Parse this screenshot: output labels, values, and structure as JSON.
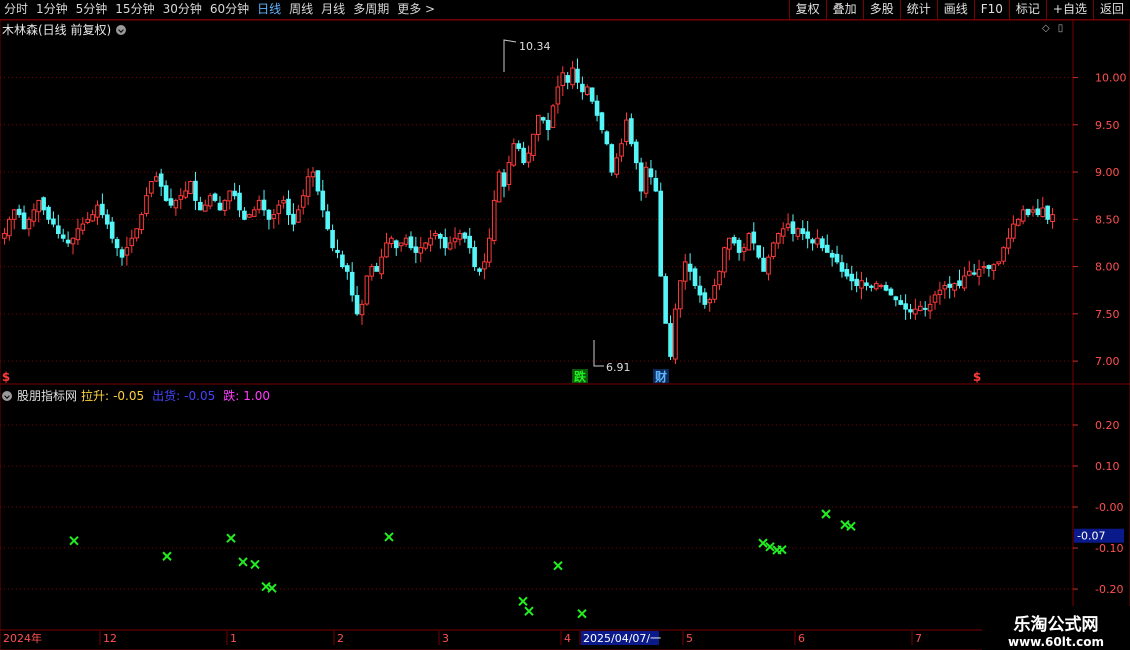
{
  "toolbar": {
    "periods": [
      {
        "label": "分时",
        "active": false
      },
      {
        "label": "1分钟",
        "active": false
      },
      {
        "label": "5分钟",
        "active": false
      },
      {
        "label": "15分钟",
        "active": false
      },
      {
        "label": "30分钟",
        "active": false
      },
      {
        "label": "60分钟",
        "active": false
      },
      {
        "label": "日线",
        "active": true
      },
      {
        "label": "周线",
        "active": false
      },
      {
        "label": "月线",
        "active": false
      },
      {
        "label": "多周期",
        "active": false
      },
      {
        "label": "更多 >",
        "active": false
      }
    ],
    "buttons": [
      "复权",
      "叠加",
      "多股",
      "统计",
      "画线",
      "F10",
      "标记",
      "+自选",
      "返回"
    ]
  },
  "stock": {
    "title": "木林森(日线 前复权)"
  },
  "indicator": {
    "name": "股朋指标网",
    "items": [
      {
        "label": "拉升:",
        "value": "-0.05",
        "color": "#ffd23c"
      },
      {
        "label": "出货:",
        "value": "-0.05",
        "color": "#4444ff"
      },
      {
        "label": "跌:",
        "value": "1.00",
        "color": "#ff3cff"
      }
    ]
  },
  "colors": {
    "up": "#ff3a3a",
    "down": "#54f6f8",
    "grid": "#7a0000",
    "cross": "#22ee22"
  },
  "chart_data": [
    {
      "type": "candlestick",
      "title": "木林森(日线 前复权)",
      "yticks": [
        "10.00",
        "9.50",
        "9.00",
        "8.50",
        "8.00",
        "7.50",
        "7.00"
      ],
      "ylim": [
        6.8,
        10.45
      ],
      "high_label": "10.34",
      "low_label": "6.91",
      "x_labels": [
        "2024年",
        "12",
        "1",
        "2",
        "3",
        "4",
        "2025/04/07/一",
        "5",
        "6",
        "7"
      ],
      "markers": [
        {
          "text": "$",
          "color": "#ff3a3a"
        },
        {
          "text": "跌",
          "color": "#22ee22"
        },
        {
          "text": "财",
          "color": "#5fb4ff"
        },
        {
          "text": "$",
          "color": "#ff3a3a"
        }
      ],
      "closes": [
        8.35,
        8.5,
        8.6,
        8.55,
        8.4,
        8.5,
        8.6,
        8.7,
        8.6,
        8.5,
        8.45,
        8.35,
        8.3,
        8.25,
        8.3,
        8.4,
        8.45,
        8.5,
        8.55,
        8.65,
        8.55,
        8.45,
        8.3,
        8.2,
        8.1,
        8.2,
        8.3,
        8.4,
        8.55,
        8.75,
        8.9,
        8.95,
        8.85,
        8.7,
        8.65,
        8.7,
        8.75,
        8.8,
        8.9,
        8.7,
        8.6,
        8.65,
        8.75,
        8.7,
        8.6,
        8.7,
        8.8,
        8.75,
        8.6,
        8.5,
        8.55,
        8.6,
        8.7,
        8.6,
        8.5,
        8.55,
        8.65,
        8.7,
        8.55,
        8.45,
        8.6,
        8.75,
        8.95,
        9.0,
        8.8,
        8.6,
        8.4,
        8.2,
        8.15,
        8.0,
        7.95,
        7.7,
        7.5,
        7.6,
        7.9,
        8.0,
        7.95,
        8.1,
        8.25,
        8.3,
        8.2,
        8.25,
        8.3,
        8.2,
        8.15,
        8.2,
        8.25,
        8.3,
        8.35,
        8.3,
        8.2,
        8.25,
        8.3,
        8.35,
        8.3,
        8.2,
        8.0,
        7.95,
        8.05,
        8.3,
        8.7,
        9.0,
        8.85,
        9.1,
        9.3,
        9.25,
        9.1,
        9.2,
        9.4,
        9.6,
        9.55,
        9.45,
        9.7,
        9.9,
        10.05,
        9.95,
        10.1,
        9.95,
        9.85,
        9.9,
        9.75,
        9.6,
        9.45,
        9.3,
        9.0,
        9.15,
        9.3,
        9.55,
        9.3,
        9.1,
        8.8,
        9.05,
        8.95,
        8.8,
        7.9,
        7.4,
        7.05,
        7.55,
        7.85,
        8.05,
        7.95,
        7.8,
        7.7,
        7.6,
        7.65,
        7.8,
        7.95,
        8.2,
        8.3,
        8.25,
        8.15,
        8.2,
        8.35,
        8.25,
        8.1,
        7.95,
        8.1,
        8.25,
        8.35,
        8.4,
        8.45,
        8.35,
        8.4,
        8.35,
        8.3,
        8.25,
        8.3,
        8.2,
        8.15,
        8.1,
        8.05,
        7.95,
        7.9,
        7.85,
        7.8,
        7.85,
        7.8,
        7.78,
        7.82,
        7.8,
        7.75,
        7.7,
        7.65,
        7.6,
        7.55,
        7.52,
        7.55,
        7.58,
        7.55,
        7.6,
        7.7,
        7.75,
        7.8,
        7.78,
        7.82,
        7.8,
        7.9,
        7.95,
        7.92,
        7.97,
        8.0,
        7.98,
        8.02,
        8.05,
        8.2,
        8.3,
        8.45,
        8.5,
        8.6,
        8.55,
        8.6,
        8.55,
        8.62,
        8.5,
        8.55
      ],
      "indicator_yticks": [
        "0.20",
        "0.10",
        "-0.00",
        "-0.10",
        "-0.20"
      ],
      "indicator_ylim": [
        -0.295,
        0.3
      ],
      "indicator_current": "-0.07",
      "signals": [
        {
          "x": 74,
          "y": -0.082
        },
        {
          "x": 167,
          "y": -0.12
        },
        {
          "x": 231,
          "y": -0.076
        },
        {
          "x": 243,
          "y": -0.134
        },
        {
          "x": 255,
          "y": -0.14
        },
        {
          "x": 266,
          "y": -0.194
        },
        {
          "x": 272,
          "y": -0.198
        },
        {
          "x": 389,
          "y": -0.073
        },
        {
          "x": 523,
          "y": -0.23
        },
        {
          "x": 529,
          "y": -0.254
        },
        {
          "x": 558,
          "y": -0.143
        },
        {
          "x": 582,
          "y": -0.26
        },
        {
          "x": 763,
          "y": -0.088
        },
        {
          "x": 770,
          "y": -0.097
        },
        {
          "x": 777,
          "y": -0.105
        },
        {
          "x": 782,
          "y": -0.104
        },
        {
          "x": 826,
          "y": -0.017
        },
        {
          "x": 845,
          "y": -0.043
        },
        {
          "x": 851,
          "y": -0.047
        }
      ]
    }
  ],
  "watermark": {
    "line1": "乐淘公式网",
    "line2": "www.60lt.com"
  }
}
